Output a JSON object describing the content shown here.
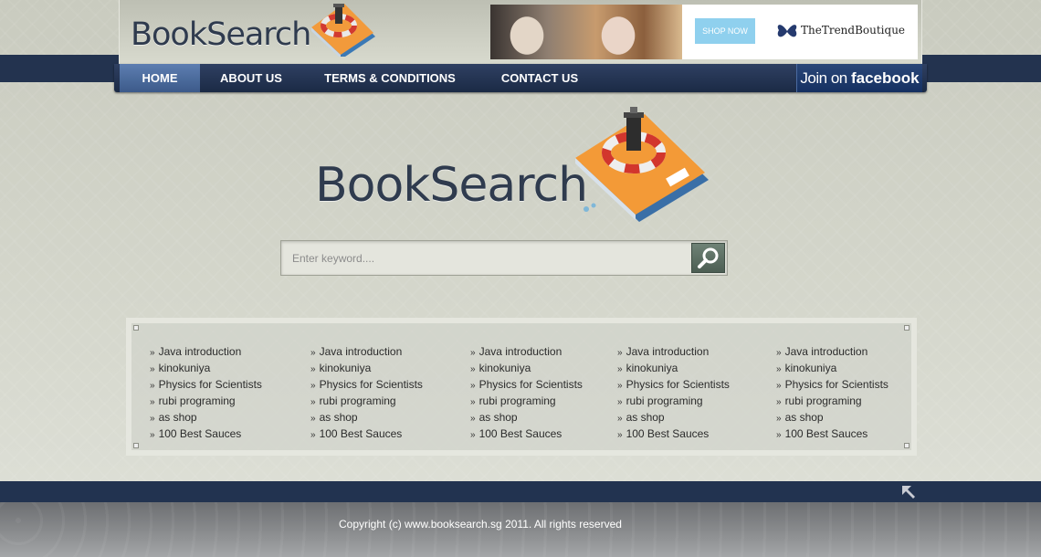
{
  "brand": {
    "logo_text": "BookSearch"
  },
  "nav": {
    "items": [
      {
        "label": "HOME",
        "active": true
      },
      {
        "label": "ABOUT US",
        "active": false
      },
      {
        "label": "TERMS & CONDITIONS",
        "active": false
      },
      {
        "label": "CONTACT US",
        "active": false
      }
    ],
    "facebook": {
      "light": "Join on ",
      "bold": "facebook"
    }
  },
  "banner": {
    "shop_now": "SHOP NOW",
    "brand": "TheTrendBoutique"
  },
  "search": {
    "placeholder": "Enter keyword...."
  },
  "links": {
    "columns": [
      [
        "Java introduction",
        "kinokuniya",
        "Physics for Scientists",
        "rubi programing",
        "as shop",
        "100 Best Sauces"
      ],
      [
        "Java introduction",
        "kinokuniya",
        "Physics for Scientists",
        "rubi programing",
        "as shop",
        "100 Best Sauces"
      ],
      [
        "Java introduction",
        "kinokuniya",
        "Physics for Scientists",
        "rubi programing",
        "as shop",
        "100 Best Sauces"
      ],
      [
        "Java introduction",
        "kinokuniya",
        "Physics for Scientists",
        "rubi programing",
        "as shop",
        "100 Best Sauces"
      ],
      [
        "Java introduction",
        "kinokuniya",
        "Physics for Scientists",
        "rubi programing",
        "as shop",
        "100 Best Sauces"
      ]
    ]
  },
  "footer": {
    "copyright": "Copyright (c) www.booksearch.sg 2011. All rights reserved"
  },
  "colors": {
    "nav": "#23334f",
    "nav_active": "#4c6c9e",
    "facebook": "#1d3a6c",
    "search_button": "#5b6d61"
  },
  "icons": {
    "search": "magnifier-icon",
    "to_top": "arrow-up-left-icon",
    "logo": "book-lighthouse-icon"
  }
}
